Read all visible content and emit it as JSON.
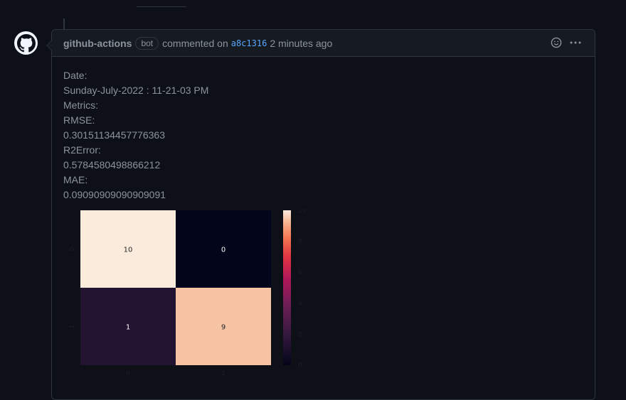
{
  "comment": {
    "author": "github-actions",
    "badge": "bot",
    "action_text": "commented on",
    "commit_sha": "a8c1316",
    "time_ago": "2 minutes ago"
  },
  "body": {
    "lines": [
      "Date:",
      "Sunday-July-2022 : 11-21-03 PM",
      "Metrics:",
      "RMSE:",
      "0.30151134457776363",
      "R2Error:",
      "0.5784580498866212",
      "MAE:",
      "0.09090909090909091"
    ]
  },
  "chart_data": {
    "type": "heatmap",
    "title": "",
    "xlabel": "",
    "ylabel": "",
    "x_tick_labels": [
      "0",
      "1"
    ],
    "y_tick_labels": [
      "0",
      "1"
    ],
    "matrix": [
      [
        10,
        0
      ],
      [
        1,
        9
      ]
    ],
    "colorbar": {
      "min": 0,
      "max": 10,
      "ticks": [
        "0",
        "2",
        "4",
        "6",
        "8",
        "10"
      ],
      "colormap": "rocket"
    },
    "cell_colors": {
      "10": "#faebdd",
      "0": "#03051a",
      "1": "#221331",
      "9": "#f6c3a5"
    }
  }
}
